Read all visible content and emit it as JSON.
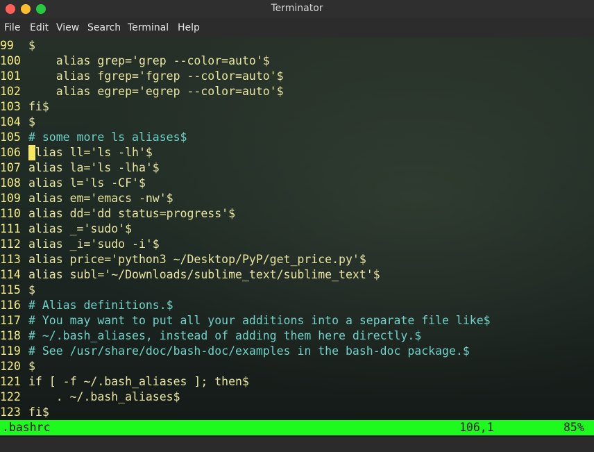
{
  "window": {
    "title": "Terminator"
  },
  "menu": [
    "File",
    "Edit",
    "View",
    "Search",
    "Terminal",
    "Help"
  ],
  "lines": [
    {
      "n": "99",
      "text": "$",
      "type": "code"
    },
    {
      "n": "100",
      "text": "    alias grep='grep --color=auto'$",
      "type": "code"
    },
    {
      "n": "101",
      "text": "    alias fgrep='fgrep --color=auto'$",
      "type": "code"
    },
    {
      "n": "102",
      "text": "    alias egrep='egrep --color=auto'$",
      "type": "code"
    },
    {
      "n": "103",
      "text": "fi$",
      "type": "code"
    },
    {
      "n": "104",
      "text": "$",
      "type": "code"
    },
    {
      "n": "105",
      "text": "# some more ls aliases$",
      "type": "comment"
    },
    {
      "n": "106",
      "text": "alias ll='ls -lh'$",
      "type": "code"
    },
    {
      "n": "107",
      "text": "alias la='ls -lha'$",
      "type": "code"
    },
    {
      "n": "108",
      "text": "alias l='ls -CF'$",
      "type": "code"
    },
    {
      "n": "109",
      "text": "alias em='emacs -nw'$",
      "type": "code"
    },
    {
      "n": "110",
      "text": "alias dd='dd status=progress'$",
      "type": "code"
    },
    {
      "n": "111",
      "text": "alias _='sudo'$",
      "type": "code"
    },
    {
      "n": "112",
      "text": "alias _i='sudo -i'$",
      "type": "code"
    },
    {
      "n": "113",
      "text": "alias price='python3 ~/Desktop/PyP/get_price.py'$",
      "type": "code"
    },
    {
      "n": "114",
      "text": "alias subl='~/Downloads/sublime_text/sublime_text'$",
      "type": "code"
    },
    {
      "n": "115",
      "text": "$",
      "type": "code"
    },
    {
      "n": "116",
      "text": "# Alias definitions.$",
      "type": "comment"
    },
    {
      "n": "117",
      "text": "# You may want to put all your additions into a separate file like$",
      "type": "comment"
    },
    {
      "n": "118",
      "text": "# ~/.bash_aliases, instead of adding them here directly.$",
      "type": "comment"
    },
    {
      "n": "119",
      "text": "# See /usr/share/doc/bash-doc/examples in the bash-doc package.$",
      "type": "comment"
    },
    {
      "n": "120",
      "text": "$",
      "type": "code"
    },
    {
      "n": "121",
      "text": "if [ -f ~/.bash_aliases ]; then$",
      "type": "code"
    },
    {
      "n": "122",
      "text": "    . ~/.bash_aliases$",
      "type": "code"
    },
    {
      "n": "123",
      "text": "fi$",
      "type": "code"
    }
  ],
  "status": {
    "file": ".bashrc",
    "position": "106,1",
    "percent": "85%"
  },
  "colors": {
    "status_bg": "#1ef91e",
    "line_number": "#f6f083",
    "comment": "#6fd3c8"
  },
  "cursor": {
    "line": "106",
    "col": "1"
  }
}
